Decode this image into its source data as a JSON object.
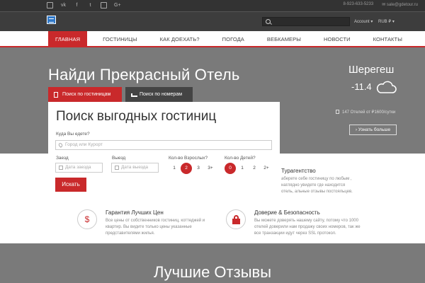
{
  "topbar": {
    "social_icons": [
      "rss-icon",
      "vk-icon",
      "facebook-icon",
      "twitter-icon",
      "instagram-icon",
      "google-plus-icon"
    ],
    "phone": "8-923-633-5233",
    "email": "sale@gdetour.ru"
  },
  "header": {
    "account_label": "Account",
    "currency_label": "RUB ₽"
  },
  "nav": {
    "items": [
      {
        "label": "Главная",
        "active": true
      },
      {
        "label": "Гостиницы"
      },
      {
        "label": "Как доехать?"
      },
      {
        "label": "Погода"
      },
      {
        "label": "Вебкамеры"
      },
      {
        "label": "Новости"
      },
      {
        "label": "Контакты"
      }
    ]
  },
  "hero": {
    "title": "Найди Прекрасный Отель",
    "city": "Шерегеш",
    "temperature": "-11.4",
    "hotels_info": "147 Отелей от ₽1600/сутки",
    "more_button": "Узнать больше"
  },
  "tabs": {
    "hotels": "Поиск по гостиницам",
    "rooms": "Поиск по номерам"
  },
  "search": {
    "title": "Поиск выгодных гостиниц",
    "destination_label": "Куда Вы едете?",
    "destination_placeholder": "Город или Курорт",
    "checkin_label": "Заезд",
    "checkin_placeholder": "Дата заезда",
    "checkout_label": "Выезд",
    "checkout_placeholder": "Дата выезда",
    "adults_label": "Кол-во Взрослых?",
    "adults_options": [
      "1",
      "2",
      "3",
      "3+"
    ],
    "adults_selected": 1,
    "children_label": "Кол-во Детей?",
    "children_options": [
      "0",
      "1",
      "2",
      "2+"
    ],
    "children_selected": 0,
    "button": "Искать"
  },
  "agency": {
    "title": "Турагентство",
    "text": "аберете себе гостиницу по любым , наглядно увидете где находится отель, альные отзывы постояльцев."
  },
  "features": [
    {
      "title": "Гарантия Лучших Цен",
      "text": "Все цены от собственников гостиниц, коттеджей и квартир. Вы видите только цены указанные представителями жилья.",
      "icon": "dollar-icon"
    },
    {
      "title": "Доверие & Безопасность",
      "text": "Вы можете доверять нашему сайту, потому что 1000 отелей доверили нам продажу своих номеров, так же все транзакции идут через SSL протокол.",
      "icon": "lock-icon"
    }
  ],
  "reviews": {
    "title": "Лучшие Отзывы"
  },
  "colors": {
    "accent": "#c9292b",
    "hero_bg": "#7a7a7a",
    "topbar_bg": "#333333",
    "header_bg": "#3d3d3d"
  }
}
